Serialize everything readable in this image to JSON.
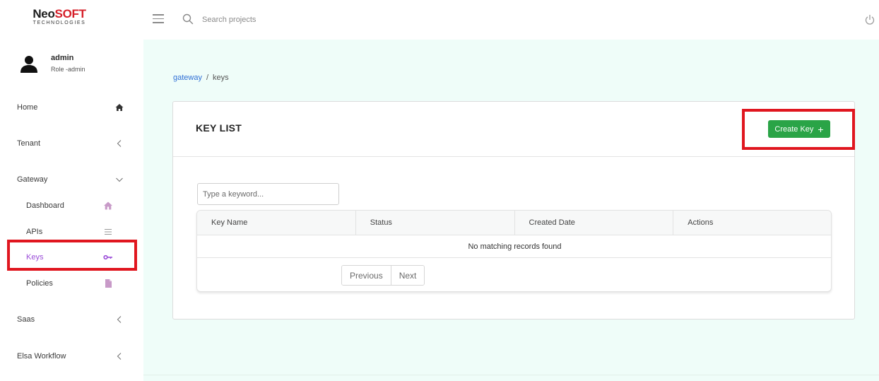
{
  "header": {
    "logo_main_a": "Neo",
    "logo_main_b": "SOFT",
    "logo_sub": "TECHNOLOGIES",
    "search_placeholder": "Search projects",
    "icons": {
      "menu": "hamburger-icon",
      "search": "search-icon",
      "power": "power-icon"
    }
  },
  "user": {
    "name": "admin",
    "role": "Role -admin"
  },
  "sidebar": {
    "items": [
      {
        "label": "Home",
        "icon": "home-icon"
      },
      {
        "label": "Tenant",
        "icon": "chevron-left-icon"
      },
      {
        "label": "Gateway",
        "icon": "chevron-down-icon"
      },
      {
        "label": "Dashboard",
        "icon": "house-icon"
      },
      {
        "label": "APIs",
        "icon": "list-icon"
      },
      {
        "label": "Keys",
        "icon": "key-icon",
        "active": true
      },
      {
        "label": "Policies",
        "icon": "document-icon"
      },
      {
        "label": "Saas",
        "icon": "chevron-left-icon"
      },
      {
        "label": "Elsa Workflow",
        "icon": "chevron-left-icon"
      }
    ]
  },
  "breadcrumb": {
    "parent": "gateway",
    "separator": "/",
    "current": "keys"
  },
  "card": {
    "title": "KEY LIST",
    "create_label": "Create Key",
    "create_icon": "+",
    "keyword_placeholder": "Type a keyword...",
    "columns": [
      "Key Name",
      "Status",
      "Created Date",
      "Actions"
    ],
    "empty_message": "No matching records found",
    "pager": {
      "previous": "Previous",
      "next": "Next"
    }
  },
  "colors": {
    "accent_green": "#2aa447",
    "active_purple": "#9b4dd8",
    "link_blue": "#2f6fd6",
    "highlight_red": "#e0161f",
    "main_bg": "#effdf9"
  }
}
